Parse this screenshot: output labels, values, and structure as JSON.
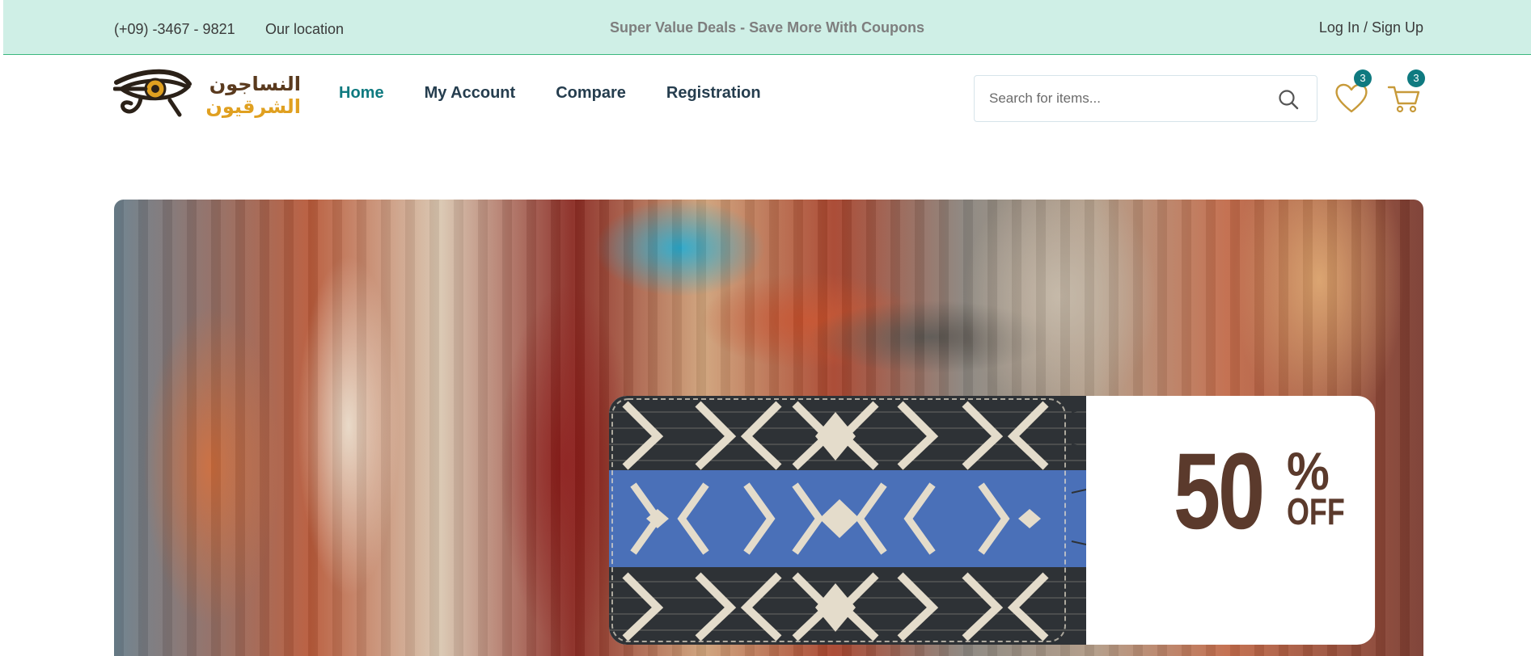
{
  "topbar": {
    "phone": "(+09) -3467 - 9821",
    "location": "Our location",
    "deals": "Super Value Deals - Save More With Coupons",
    "login": "Log In / Sign Up"
  },
  "brand": {
    "logo_text_line1": "النساجون",
    "logo_text_line2": "الشرقيون",
    "colors": {
      "gold": "#e0a020",
      "brown": "#5a3a1e"
    }
  },
  "nav": {
    "items": [
      {
        "label": "Home",
        "active": true
      },
      {
        "label": "My Account",
        "active": false
      },
      {
        "label": "Compare",
        "active": false
      },
      {
        "label": "Registration",
        "active": false
      }
    ]
  },
  "search": {
    "placeholder": "Search for items..."
  },
  "header_icons": {
    "wishlist": {
      "icon": "heart-icon",
      "count": "3"
    },
    "cart": {
      "icon": "cart-icon",
      "count": "3"
    }
  },
  "hero": {
    "promo": {
      "value": "50",
      "percent": "%",
      "off": "OFF"
    }
  },
  "colors": {
    "topbar_bg": "#cfefe6",
    "accent": "#0f7a80",
    "promo_text": "#5b3a2c",
    "text": "#253d4e"
  }
}
